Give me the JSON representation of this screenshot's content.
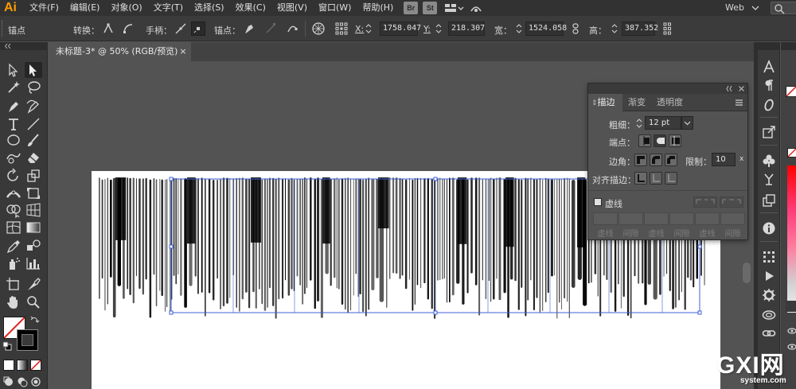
{
  "app": {
    "logo": "Ai"
  },
  "menus": [
    "文件(F)",
    "编辑(E)",
    "对象(O)",
    "文字(T)",
    "选择(S)",
    "效果(C)",
    "视图(V)",
    "窗口(W)",
    "帮助(H)"
  ],
  "menubar": {
    "bridge_label": "Br",
    "stock_label": "St",
    "workspace": "Web"
  },
  "controlbar": {
    "mode": "锚点",
    "convert_label": "转换：",
    "handles_label": "手柄：",
    "anchors_label": "锚点：",
    "x_label": "X:",
    "x_value": "1758.047",
    "y_label": "Y:",
    "y_value": "218.307",
    "w_label": "宽：",
    "w_value": "1524.058",
    "h_label": "高：",
    "h_value": "387.352"
  },
  "document_tab": {
    "title": "未标题-3* @ 50% (RGB/预览)",
    "close": "×"
  },
  "stroke_panel": {
    "tabs": [
      "描边",
      "渐变",
      "透明度"
    ],
    "active_tab": "描边",
    "weight_label": "粗细：",
    "weight_value": "12 pt",
    "cap_label": "端点：",
    "corner_label": "边角：",
    "limit_label": "限制：",
    "limit_value": "10",
    "limit_unit": "x",
    "align_label": "对齐描边：",
    "dashed_label": "虚线",
    "dash_cells": [
      "虚线",
      "间隙",
      "虚线",
      "间隙",
      "虚线",
      "间隙"
    ]
  },
  "watermark": {
    "logo": "GXI网",
    "domain": "system.com"
  },
  "colors": {
    "menubar_bg": "#323232",
    "controlbar_bg": "#3b3b3b",
    "canvas_bg": "#535353",
    "artboard": "#ffffff",
    "selection": "#3d5fd6",
    "app_logo": "#ff9a00"
  }
}
